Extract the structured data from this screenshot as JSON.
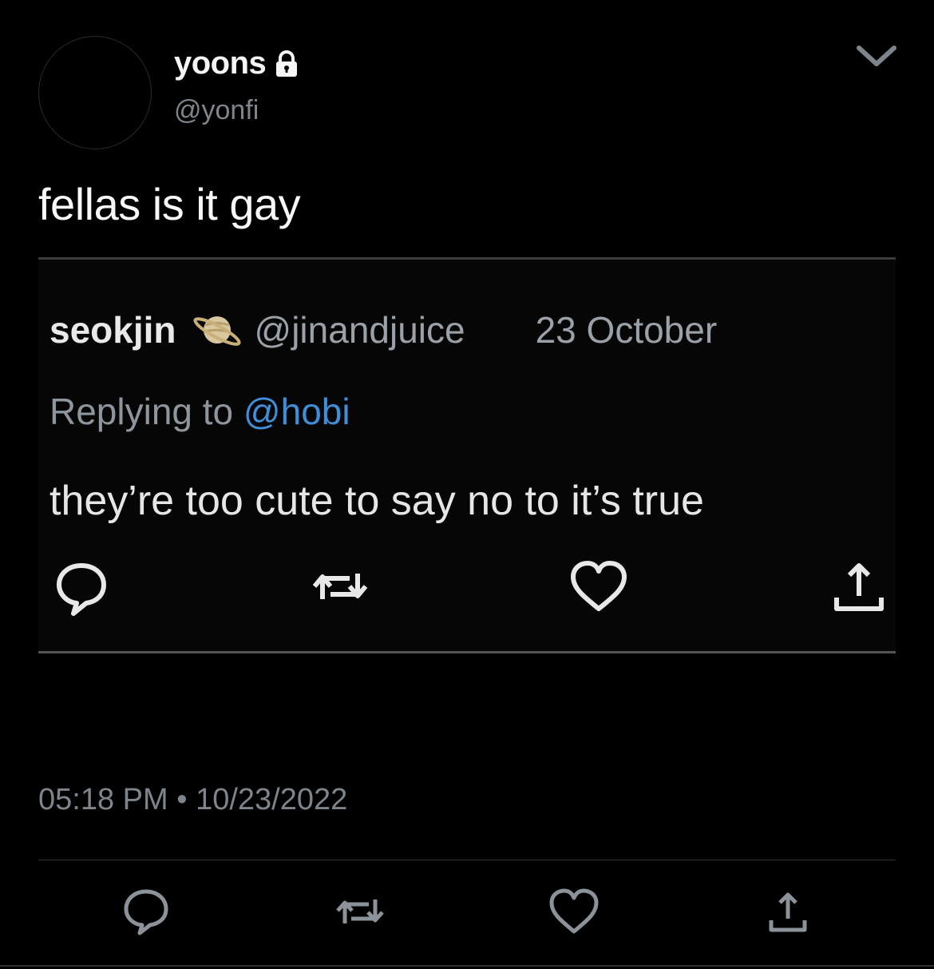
{
  "tweet": {
    "display_name": "yoons",
    "handle": "@yonfi",
    "text": "fellas is it gay",
    "timestamp": "05:18 PM • 10/23/2022",
    "icons": {
      "lock": "lock-icon",
      "menu": "chevron-down-icon"
    }
  },
  "quoted": {
    "name": "seokjin",
    "emoji": "saturn-planet-icon",
    "handle": "@jinandjuice",
    "date": "23 October",
    "replying_prefix": "Replying to ",
    "replying_to": "@hobi",
    "text": "they’re too cute to say no to it’s true",
    "actions": [
      "reply-icon",
      "retweet-icon",
      "like-icon",
      "share-icon"
    ]
  },
  "actions": [
    "reply-icon",
    "retweet-icon",
    "like-icon",
    "share-icon"
  ],
  "colors": {
    "background": "#000000",
    "text": "#f8f8f8",
    "secondary": "#7d848b",
    "mention": "#3f8ed8"
  }
}
